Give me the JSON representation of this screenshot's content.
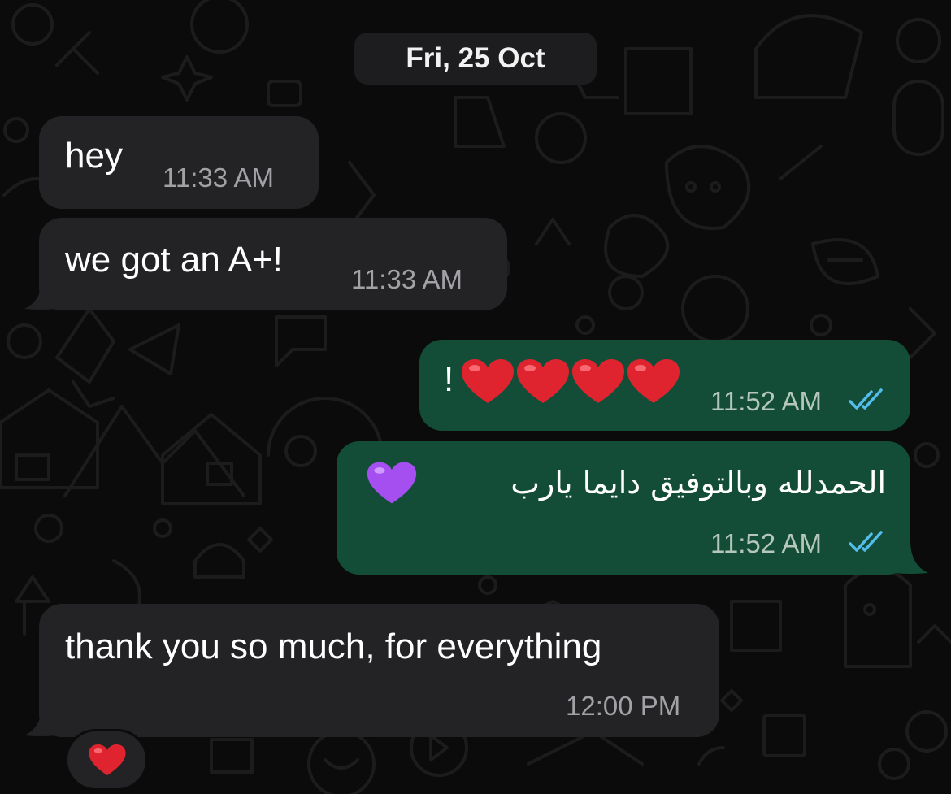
{
  "date_label": "Fri, 25 Oct",
  "messages": [
    {
      "direction": "incoming",
      "text": "hey",
      "time": "11:33 AM"
    },
    {
      "direction": "incoming",
      "text": "we got an A+!",
      "time": "11:33 AM"
    },
    {
      "direction": "outgoing",
      "text": "!",
      "emoji": "red-heart x4",
      "time": "11:52 AM",
      "status": "read"
    },
    {
      "direction": "outgoing",
      "text": "الحمدلله وبالتوفيق دايما يارب",
      "emoji": "purple-heart",
      "time": "11:52 AM",
      "status": "read"
    },
    {
      "direction": "incoming",
      "text": "thank you so much, for everything",
      "time": "12:00 PM",
      "reaction": "red-heart"
    }
  ],
  "colors": {
    "background": "#0b0b0b",
    "incoming_bubble": "#232325",
    "outgoing_bubble": "#144d37",
    "read_ticks": "#53bdeb",
    "heart_red": "#e0242f",
    "heart_purple": "#a64ff0"
  }
}
